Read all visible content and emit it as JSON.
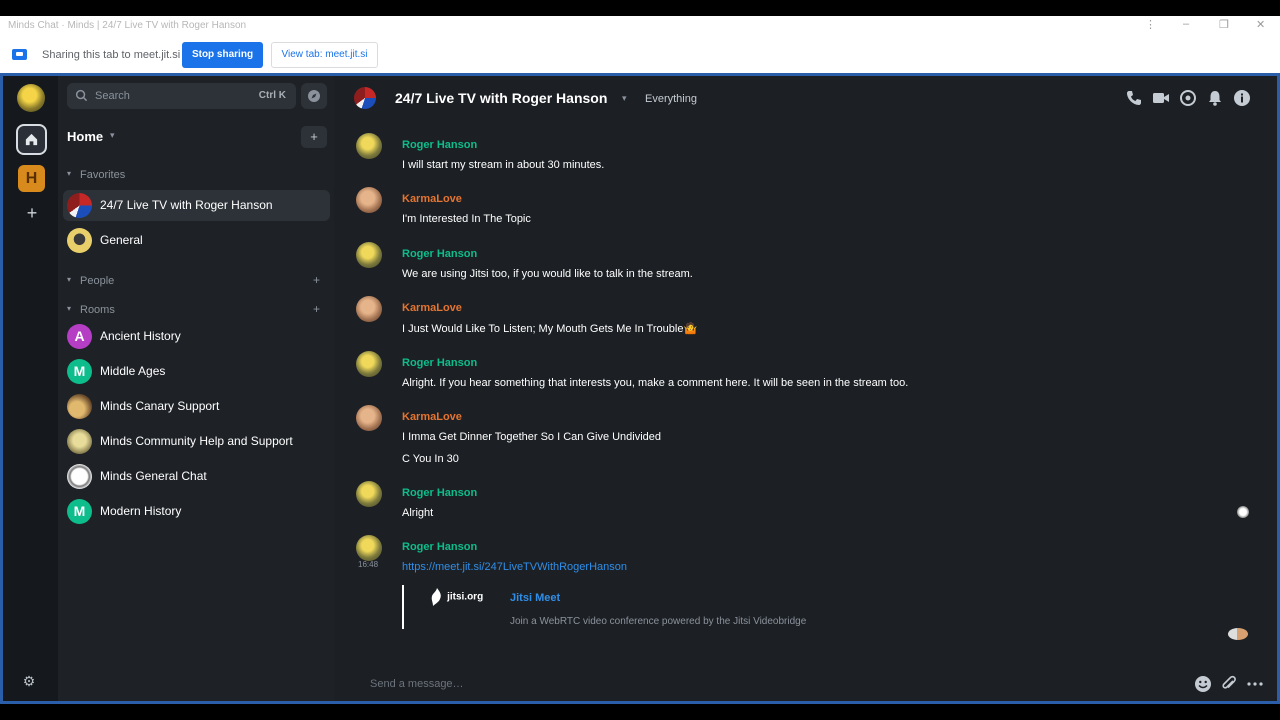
{
  "browser": {
    "window_title": "Minds Chat · Minds | 24/7 Live TV with Roger Hanson",
    "controls": {
      "menu": "⋮",
      "minimize": "–",
      "restore": "❐",
      "close": "✕"
    },
    "share_text": "Sharing this tab to meet.jit.si",
    "stop_label": "Stop sharing",
    "view_label": "View tab: meet.jit.si"
  },
  "rail": {
    "space_letter": "H",
    "add_glyph": "+",
    "settings_glyph": "⚙"
  },
  "roomlist": {
    "search_placeholder": "Search",
    "search_shortcut": "Ctrl K",
    "home_title": "Home",
    "home_add": "+",
    "sections": {
      "favorites": "Favorites",
      "people": "People",
      "rooms": "Rooms"
    },
    "favorites": [
      {
        "name": "24/7 Live TV with Roger Hanson",
        "letter": ""
      },
      {
        "name": "General",
        "letter": ""
      }
    ],
    "rooms": [
      {
        "name": "Ancient History",
        "letter": "A",
        "color": "#b53ec4"
      },
      {
        "name": "Middle Ages",
        "letter": "M",
        "color": "#0dbd8b"
      },
      {
        "name": "Minds Canary Support",
        "letter": "",
        "color": "#c8a15a"
      },
      {
        "name": "Minds Community Help and Support",
        "letter": "",
        "color": "#b3a266"
      },
      {
        "name": "Minds General Chat",
        "letter": "",
        "color": "#e8e8e8"
      },
      {
        "name": "Modern History",
        "letter": "M",
        "color": "#0dbd8b"
      }
    ]
  },
  "header": {
    "title": "24/7 Live TV with Roger Hanson",
    "topic": "Everything"
  },
  "messages": [
    {
      "sender": "Roger Hanson",
      "text": "I will start my stream in about 30 minutes."
    },
    {
      "sender": "KarmaLove",
      "text": "I'm Interested In The Topic"
    },
    {
      "sender": "Roger Hanson",
      "text": "We are using Jitsi too, if you would like to talk in the stream."
    },
    {
      "sender": "KarmaLove",
      "text": "I Just Would Like To Listen; My Mouth Gets Me In Trouble🤷"
    },
    {
      "sender": "Roger Hanson",
      "text": "Alright. If you hear something that interests you, make a comment here. It will be seen in the stream too."
    },
    {
      "sender": "KarmaLove",
      "text": "I Imma Get Dinner Together So I Can Give Undivided",
      "text2": "C You In 30"
    },
    {
      "sender": "Roger Hanson",
      "text": "Alright"
    },
    {
      "sender": "Roger Hanson",
      "timestamp": "16:48",
      "link": "https://meet.jit.si/247LiveTVWithRogerHanson"
    }
  ],
  "preview": {
    "logo_text": "jitsi.org",
    "title": "Jitsi Meet",
    "description": "Join a WebRTC video conference powered by the Jitsi Videobridge"
  },
  "composer": {
    "placeholder": "Send a message…"
  },
  "colors": {
    "accent_green": "#0dbd8b",
    "sender_orange": "#e47430",
    "link_blue": "#2f8ee8",
    "share_blue": "#1a73e8"
  }
}
